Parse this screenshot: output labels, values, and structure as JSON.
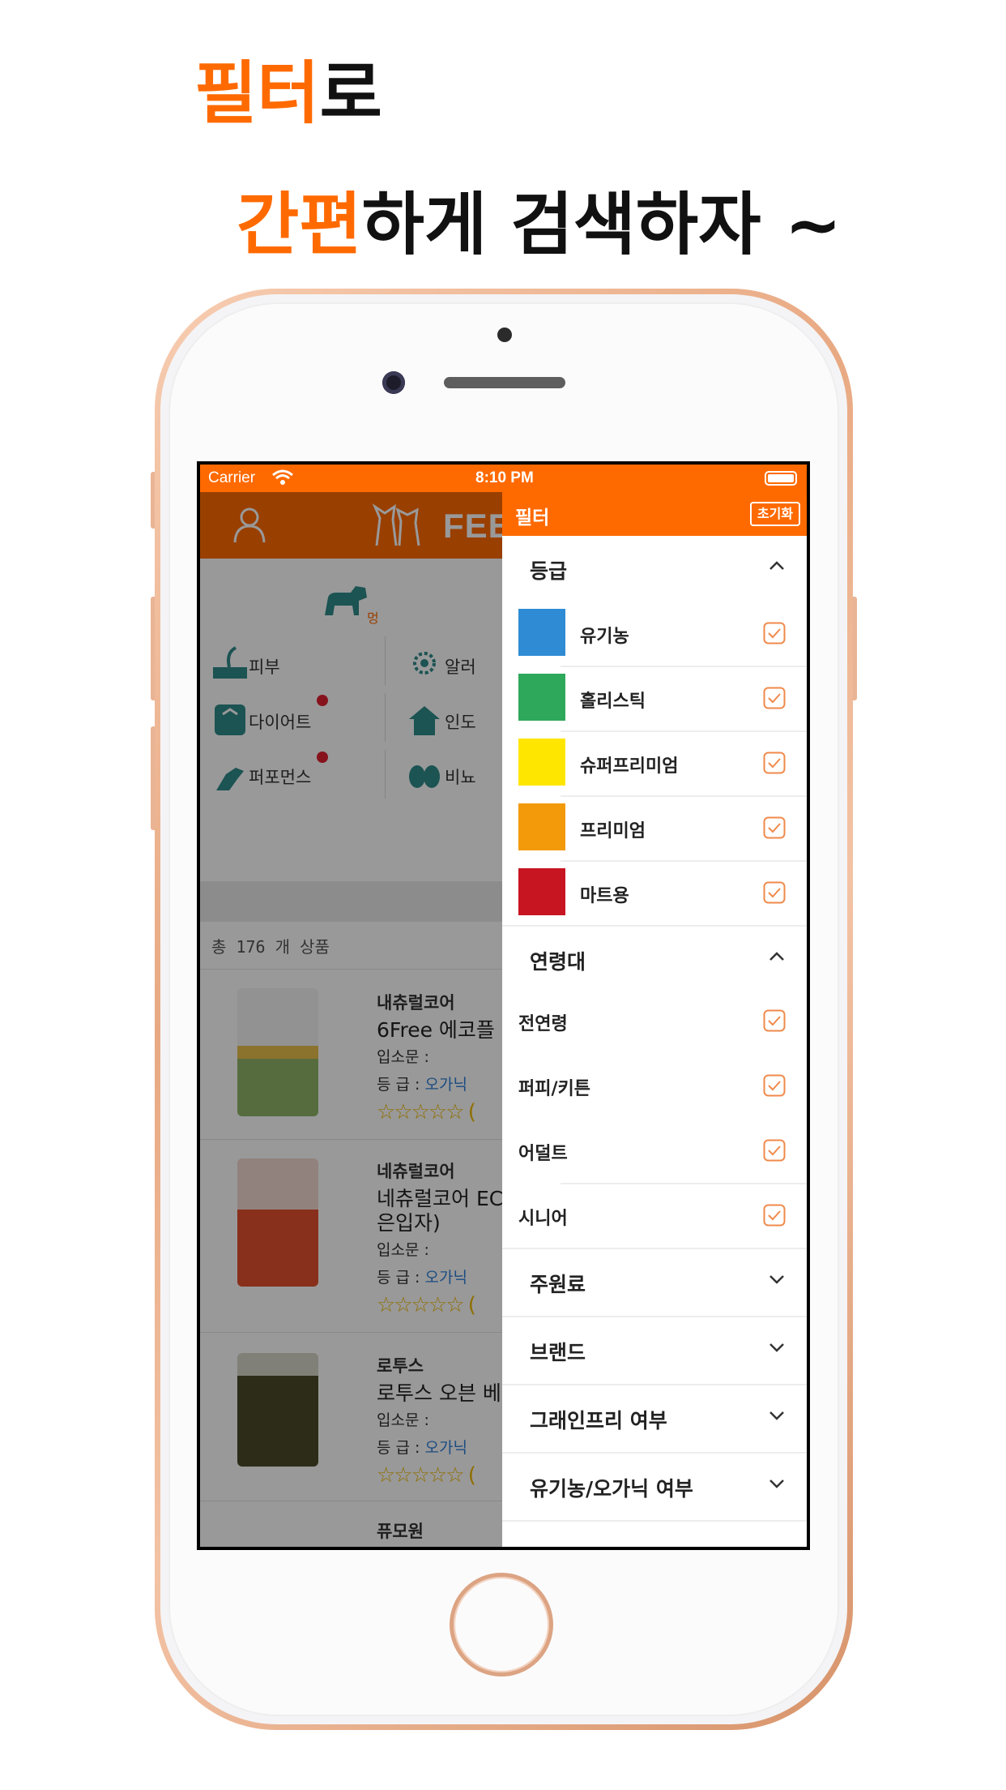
{
  "headline": {
    "line1_accent": "필터",
    "line1_rest": "로",
    "line2_accent": "간편",
    "line2_rest": "하게 검색하자 ~"
  },
  "colors": {
    "accent": "#ff6a00",
    "phone_frame": "#e8a982",
    "checkbox": "#f08a4b"
  },
  "statusbar": {
    "carrier": "Carrier",
    "time": "8:10 PM"
  },
  "background_app": {
    "logo_text": "FEE",
    "dog_tab_label": "멍",
    "categories": [
      {
        "label": "피부",
        "icon": "skin-icon"
      },
      {
        "label": "알러",
        "icon": "allergy-icon"
      },
      {
        "label": "다이어트",
        "icon": "scale-icon"
      },
      {
        "label": "인도",
        "icon": "house-icon"
      },
      {
        "label": "퍼포먼스",
        "icon": "muscle-icon"
      },
      {
        "label": "비뇨",
        "icon": "kidney-icon"
      }
    ],
    "total": "총 176 개 상품",
    "products": [
      {
        "brand": "내츄럴코어",
        "name": "6Free 에코플",
        "meta1": "입소문 :",
        "meta2_label": "등  급 :",
        "meta2_value": "오가닉",
        "stars": "☆☆☆☆☆ ("
      },
      {
        "brand": "네츄럴코어",
        "name": "네츄럴코어 EC",
        "name2": "은입자)",
        "meta1": "입소문 :",
        "meta2_label": "등  급 :",
        "meta2_value": "오가닉",
        "stars": "☆☆☆☆☆ ("
      },
      {
        "brand": "로투스",
        "name": "로투스 오븐 베",
        "meta1": "입소문 :",
        "meta2_label": "등  급 :",
        "meta2_value": "오가닉",
        "stars": "☆☆☆☆☆ ("
      },
      {
        "brand": "퓨모원"
      }
    ]
  },
  "filter": {
    "title": "필터",
    "reset_label": "초기화",
    "sections": [
      {
        "title": "등급",
        "expanded": true,
        "items": [
          {
            "label": "유기농",
            "color": "#2f8cd4",
            "checked": true
          },
          {
            "label": "홀리스틱",
            "color": "#2ea85a",
            "checked": true
          },
          {
            "label": "슈퍼프리미엄",
            "color": "#ffe600",
            "checked": true
          },
          {
            "label": "프리미엄",
            "color": "#f39a0a",
            "checked": true
          },
          {
            "label": "마트용",
            "color": "#c81522",
            "checked": true
          }
        ]
      },
      {
        "title": "연령대",
        "expanded": true,
        "items": [
          {
            "label": "전연령",
            "checked": true
          },
          {
            "label": "퍼피/키튼",
            "checked": true
          },
          {
            "label": "어덜트",
            "checked": true
          },
          {
            "label": "시니어",
            "checked": true
          }
        ]
      },
      {
        "title": "주원료",
        "expanded": false
      },
      {
        "title": "브랜드",
        "expanded": false
      },
      {
        "title": "그래인프리 여부",
        "expanded": false
      },
      {
        "title": "유기농/오가닉 여부",
        "expanded": false
      }
    ]
  }
}
